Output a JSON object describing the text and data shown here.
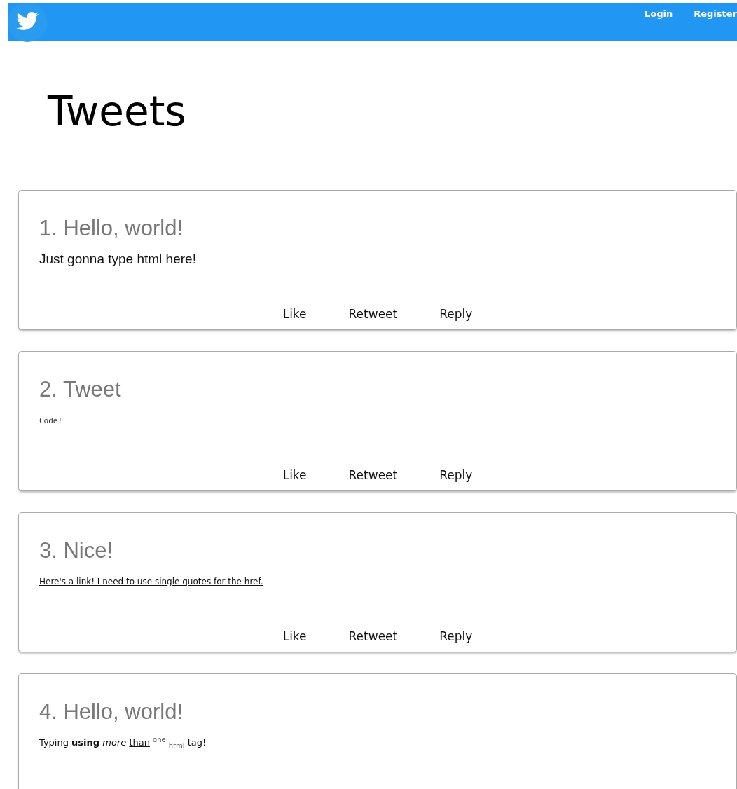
{
  "navbar": {
    "links": [
      {
        "label": "Login"
      },
      {
        "label": "Register"
      }
    ]
  },
  "page_title": "Tweets",
  "tweets": [
    {
      "title": "1. Hello, world!",
      "body": {
        "kind": "text",
        "text": "Just gonna type html here!"
      },
      "actions": [
        "Like",
        "Retweet",
        "Reply"
      ]
    },
    {
      "title": "2. Tweet",
      "body": {
        "kind": "code",
        "text": "Code!"
      },
      "actions": [
        "Like",
        "Retweet",
        "Reply"
      ]
    },
    {
      "title": "3. Nice!",
      "body": {
        "kind": "link",
        "text": "Here's a link! I need to use single quotes for the href."
      },
      "actions": [
        "Like",
        "Retweet",
        "Reply"
      ]
    },
    {
      "title": "4. Hello, world!",
      "body": {
        "kind": "mixed",
        "segments": [
          {
            "kind": "rich",
            "text": "Typing **using** *more* "
          },
          {
            "kind": "underline",
            "text": "than"
          },
          {
            "kind": "rich",
            "text": " $^{one}$ $_{html}$ "
          },
          {
            "kind": "strike",
            "text": "tag"
          },
          {
            "kind": "rich",
            "text": "!"
          }
        ]
      }
    }
  ]
}
